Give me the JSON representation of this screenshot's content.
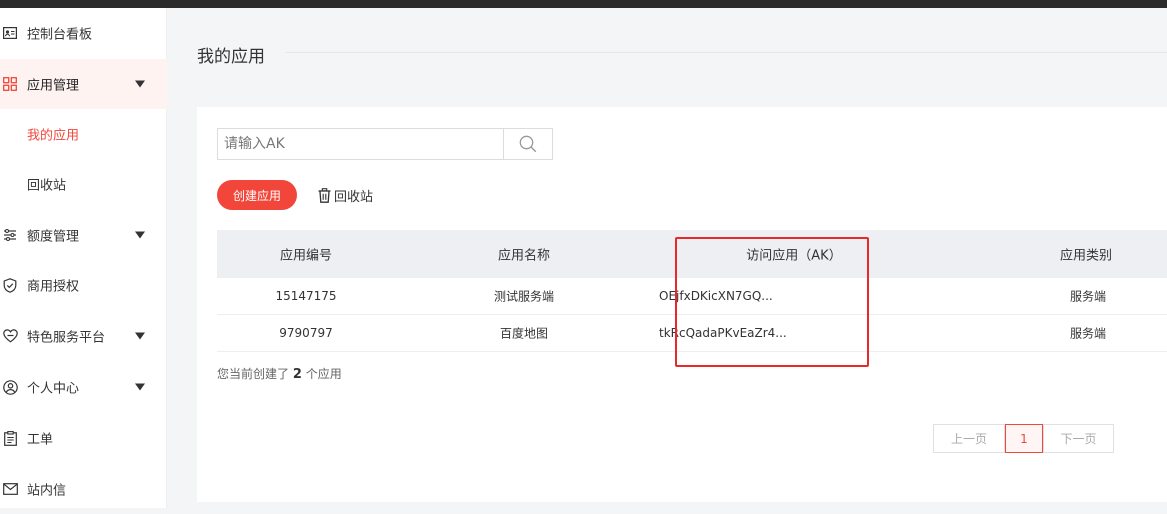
{
  "sidebar": {
    "items": [
      {
        "label": "控制台看板"
      },
      {
        "label": "应用管理"
      },
      {
        "label": "我的应用"
      },
      {
        "label": "回收站"
      },
      {
        "label": "额度管理"
      },
      {
        "label": "商用授权"
      },
      {
        "label": "特色服务平台"
      },
      {
        "label": "个人中心"
      },
      {
        "label": "工单"
      },
      {
        "label": "站内信"
      }
    ]
  },
  "main": {
    "title": "我的应用",
    "search": {
      "placeholder": "请输入AK",
      "value": ""
    },
    "create_label": "创建应用",
    "recycle_label": "回收站",
    "table": {
      "headers": [
        "应用编号",
        "应用名称",
        "访问应用（AK）",
        "应用类别"
      ],
      "rows": [
        {
          "id": "15147175",
          "name": "测试服务端",
          "ak": "OEjfxDKicXN7GQ...",
          "type": "服务端"
        },
        {
          "id": "9790797",
          "name": "百度地图",
          "ak": "tkRcQadaPKvEaZr4...",
          "type": "服务端"
        }
      ]
    },
    "summary": {
      "prefix": "您当前创建了",
      "count": "2",
      "suffix": "个应用"
    },
    "pagination": {
      "prev": "上一页",
      "current": "1",
      "next": "下一页"
    }
  },
  "colors": {
    "accent": "#f2463a",
    "highlight": "#e8292c"
  }
}
